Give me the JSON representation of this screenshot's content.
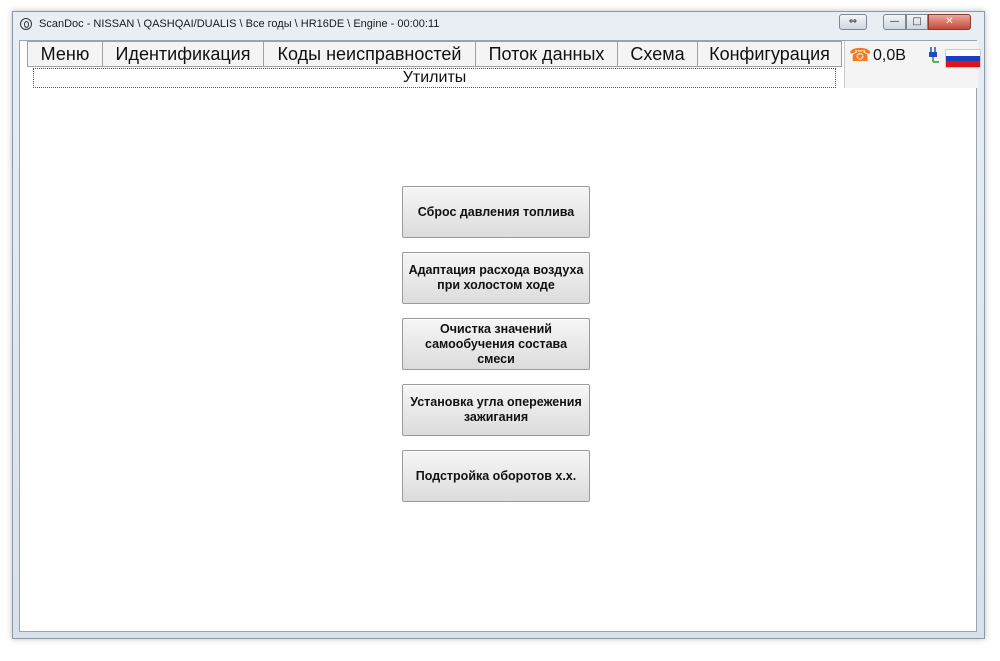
{
  "window": {
    "title": "ScanDoc - NISSAN \\ QASHQAI/DUALIS \\ Все годы \\ HR16DE \\ Engine - 00:00:11",
    "controls": {
      "arrows": "⇔",
      "minimize": "—",
      "maximize": "□",
      "close": "✕"
    }
  },
  "menu": {
    "items": [
      {
        "label": "Меню"
      },
      {
        "label": "Идентификация"
      },
      {
        "label": "Коды неисправностей"
      },
      {
        "label": "Поток данных"
      },
      {
        "label": "Схема"
      },
      {
        "label": "Конфигурация"
      }
    ]
  },
  "status": {
    "phone_icon": "phone-icon",
    "voltage": "0,0В",
    "plug_icon": "plug-icon",
    "flag_colors": [
      "#ffffff",
      "#1c3fbf",
      "#e0141b"
    ],
    "accent": "#f47a1f"
  },
  "subtitle": "Утилиты",
  "actions": [
    {
      "label": "Сброс давления топлива"
    },
    {
      "label": "Адаптация расхода воздуха при холостом ходе"
    },
    {
      "label": "Очистка значений самообучения состава смеси"
    },
    {
      "label": "Установка угла опережения зажигания"
    },
    {
      "label": "Подстройка оборотов х.х."
    }
  ]
}
